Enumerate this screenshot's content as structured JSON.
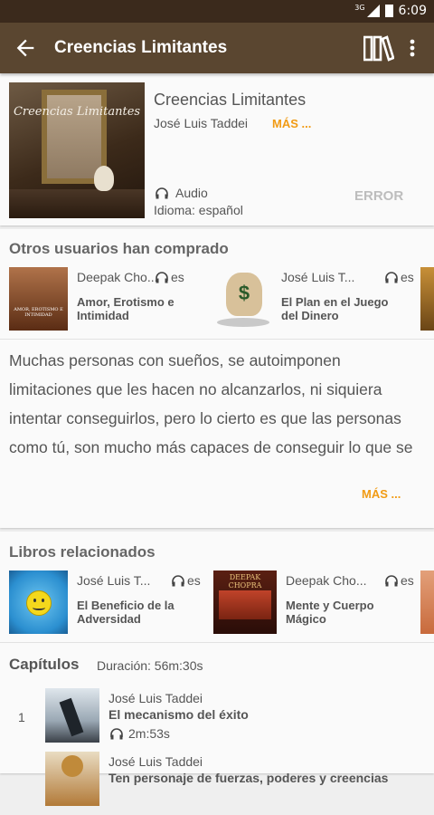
{
  "status": {
    "network": "3G",
    "time": "6:09"
  },
  "toolbar": {
    "title": "Creencias Limitantes",
    "back_icon": "arrow-back-icon",
    "library_icon": "library-books-icon",
    "more_icon": "more-vert-icon"
  },
  "book": {
    "cover_text": "Creencias Limitantes",
    "title": "Creencias Limitantes",
    "author": "José Luis Taddei",
    "more_label": "MÁS ...",
    "format": "Audio",
    "language": "Idioma: español",
    "error_label": "ERROR"
  },
  "others": {
    "heading": "Otros usuarios han comprado",
    "items": [
      {
        "author": "Deepak Cho...",
        "lang": "es",
        "title": "Amor, Erotismo e Intimidad",
        "cover_text": "AMOR, EROTISMO E INTIMIDAD"
      },
      {
        "author": "José Luis T...",
        "lang": "es",
        "title": "El Plan en el Juego del Dinero",
        "cover_text": "$"
      }
    ]
  },
  "description": {
    "text": "Muchas personas con sueños, se autoimponen limitaciones que les hacen no alcanzarlos, ni siquiera intentar conseguirlos, pero lo cierto es que las personas como tú, son mucho más capaces de conseguir lo que se",
    "more_label": "MÁS ..."
  },
  "related": {
    "heading": "Libros relacionados",
    "items": [
      {
        "author": "José Luis T...",
        "lang": "es",
        "title": "El Beneficio de la Adversidad",
        "cover_text": ""
      },
      {
        "author": "Deepak Cho...",
        "lang": "es",
        "title": "Mente y Cuerpo Mágico",
        "cover_text": "DEEPAK CHOPRA"
      }
    ]
  },
  "chapters": {
    "heading": "Capítulos",
    "duration": "Duración: 56m:30s",
    "items": [
      {
        "num": "1",
        "author": "José Luis Taddei",
        "title": "El mecanismo del éxito",
        "duration": "2m:53s"
      },
      {
        "num": "",
        "author": "José Luis Taddei",
        "title": "Ten personaje de fuerzas, poderes y creencias",
        "duration": ""
      }
    ]
  },
  "colors": {
    "statusbar": "#3b2a1c",
    "toolbar": "#5a4630",
    "accent": "#f19b14",
    "error": "#bdbdbd"
  }
}
